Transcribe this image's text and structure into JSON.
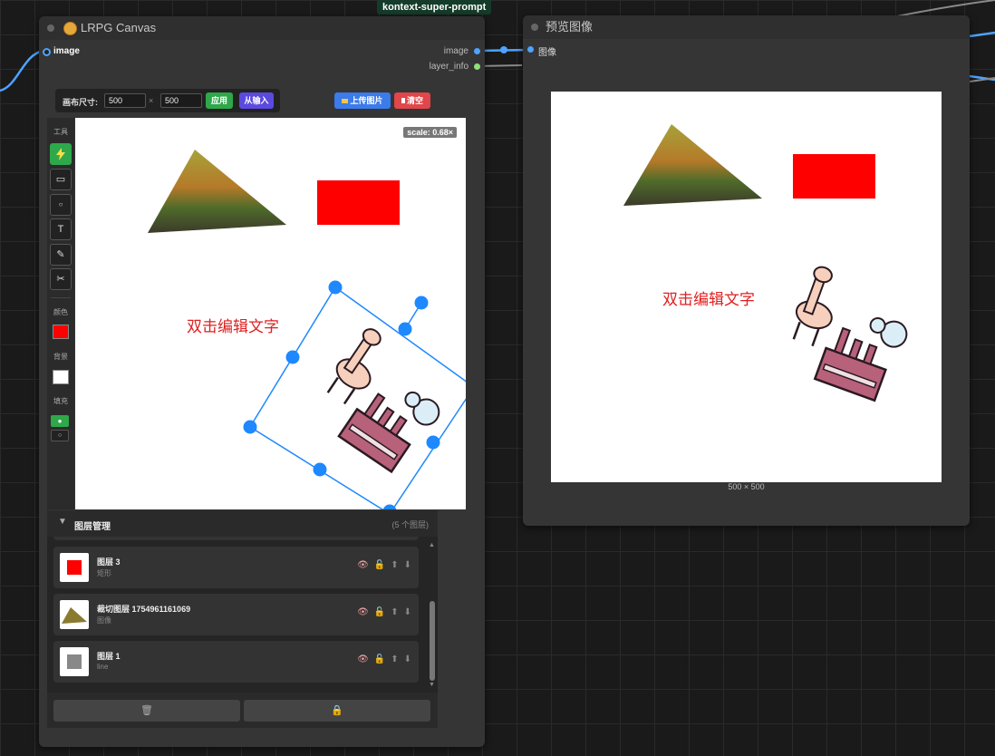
{
  "top_tag": "kontext-super-prompt",
  "lrpg_node": {
    "title": "LRPG Canvas",
    "input_slot": "image",
    "output_slots": [
      "image",
      "layer_info"
    ],
    "canvas_bar": {
      "size_label": "画布尺寸:",
      "width_value": "500",
      "times": "×",
      "height_value": "500",
      "apply_label": "应用",
      "from_input_label": "从输入",
      "upload_label": "上传图片",
      "clear_label": "清空"
    },
    "tools": {
      "section_label": "工具",
      "color_label": "颜色",
      "background_label": "背景",
      "fill_label": "填充"
    },
    "scale_badge": "scale: 0.68×",
    "canvas_text": "双击编辑文字",
    "layer_panel": {
      "title": "图层管理",
      "count": "(5 个图层)",
      "layers": [
        {
          "name": "图层 3",
          "type": "矩形"
        },
        {
          "name": "裁切图层 1754961161069",
          "type": "图像"
        },
        {
          "name": "图层 1",
          "type": "line"
        }
      ]
    }
  },
  "preview_node": {
    "title": "预览图像",
    "input_slot": "图像",
    "canvas_text": "双击编辑文字",
    "dimensions": "500 × 500"
  },
  "colors": {
    "accent_blue": "#1e88ff",
    "apply_green": "#2ea84a",
    "from_input_purple": "#5b4ae0",
    "upload_blue": "#3b7bea",
    "clear_red": "#e0464a",
    "shape_red": "#ff0000"
  }
}
